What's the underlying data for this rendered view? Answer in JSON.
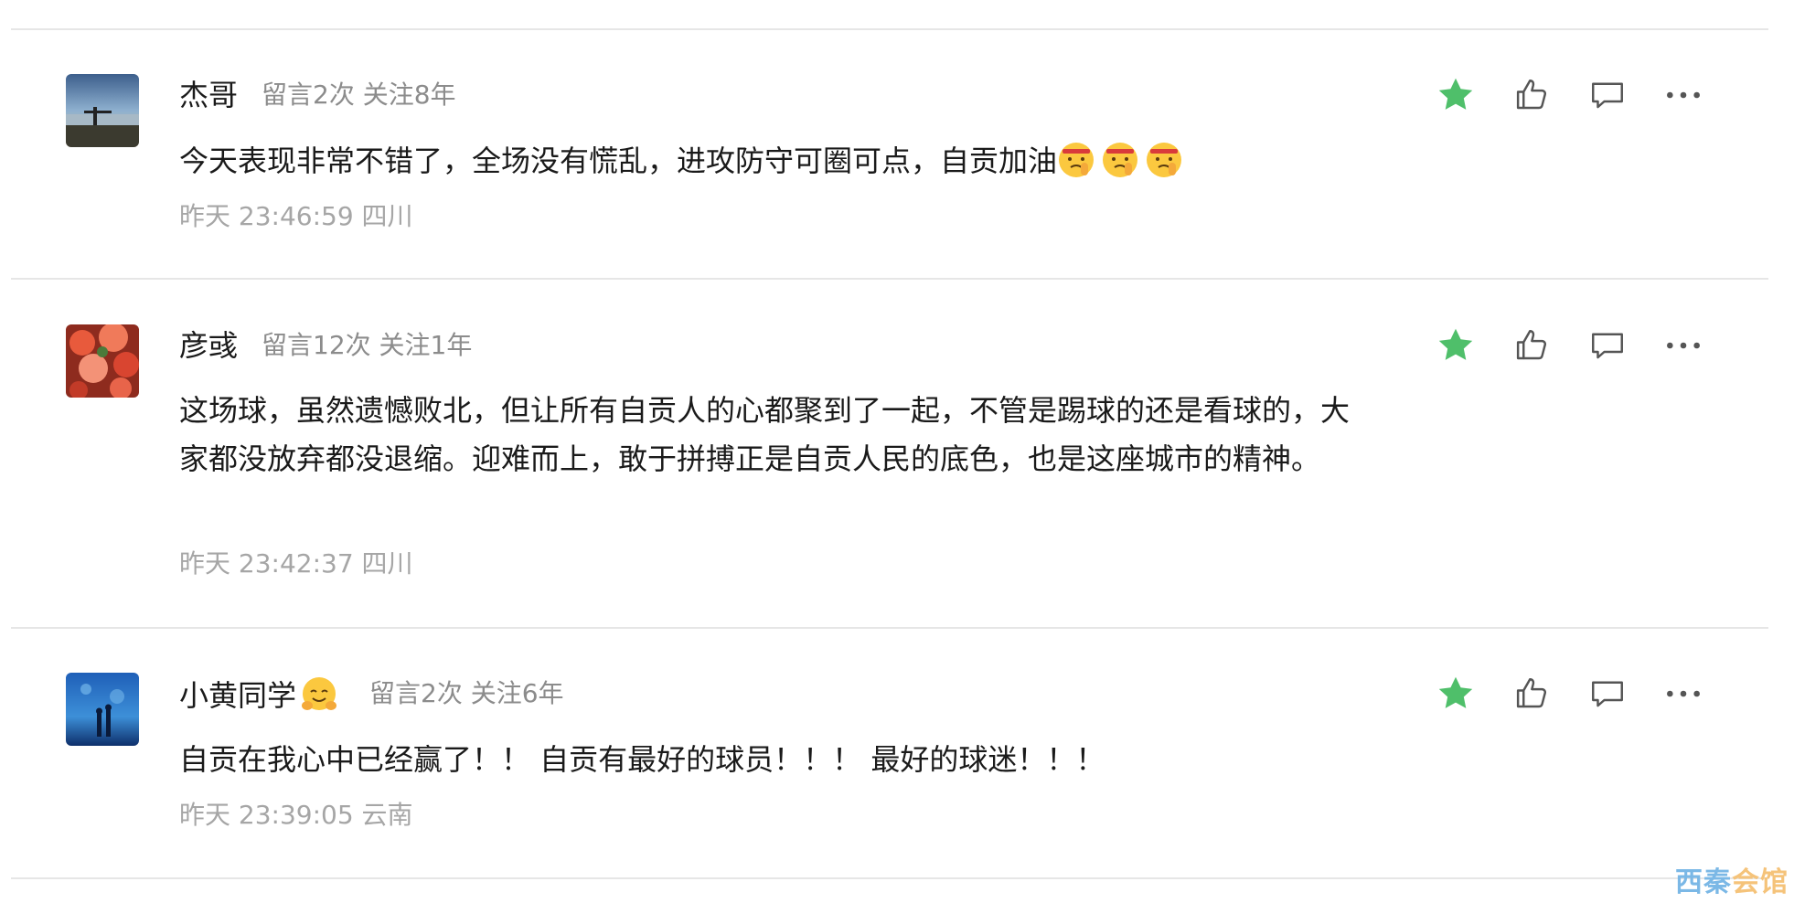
{
  "comments": [
    {
      "name": "杰哥",
      "stats": "留言2次 关注8年",
      "text": "今天表现非常不错了，全场没有慌乱，进攻防守可圈可点，自贡加油",
      "time": "昨天 23:46:59 四川"
    },
    {
      "name": "彦彧",
      "stats": "留言12次 关注1年",
      "text": "这场球，虽然遗憾败北，但让所有自贡人的心都聚到了一起，不管是踢球的还是看球的，大家都没放弃都没退缩。迎难而上，敢于拼搏正是自贡人民的底色，也是这座城市的精神。",
      "time": "昨天 23:42:37 四川"
    },
    {
      "name": "小黄同学",
      "stats": "留言2次 关注6年",
      "text": "自贡在我心中已经赢了！！ 自贡有最好的球员！！！ 最好的球迷！！！",
      "time": "昨天 23:39:05 云南"
    }
  ],
  "icons": {
    "star": "star-icon",
    "like": "thumbs-up-icon",
    "reply": "comment-icon",
    "more": "more-icon"
  },
  "colors": {
    "star": "#4fbf6a",
    "icon": "#555555"
  },
  "watermark": {
    "part1": "西秦",
    "part2": "会馆"
  }
}
